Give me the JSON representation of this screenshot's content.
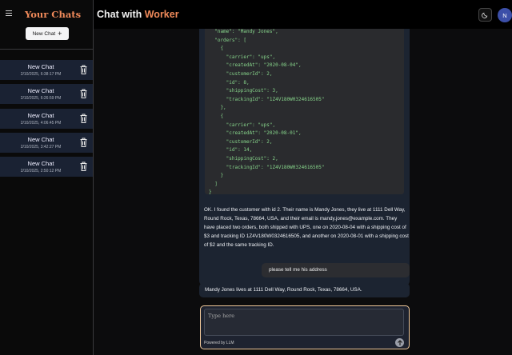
{
  "sidebar": {
    "title": "Your Chats",
    "new_chat_label": "New Chat",
    "chats": [
      {
        "title": "New Chat",
        "date": "2/10/2025, 6:38:17 PM"
      },
      {
        "title": "New Chat",
        "date": "2/10/2025, 6:26:59 PM"
      },
      {
        "title": "New Chat",
        "date": "2/10/2025, 4:06:45 PM"
      },
      {
        "title": "New Chat",
        "date": "2/10/2025, 3:42:27 PM"
      },
      {
        "title": "New Chat",
        "date": "2/10/2025, 2:50:12 PM"
      }
    ]
  },
  "header": {
    "title_prefix": "Chat with",
    "title_accent": "Worker",
    "avatar_initial": "N"
  },
  "messages": {
    "code": "  \"name\": \"Mandy Jones\",\n  \"orders\": [\n    {\n      \"carrier\": \"ups\",\n      \"createdAt\": \"2020-08-04\",\n      \"customerId\": 2,\n      \"id\": 8,\n      \"shippingCost\": 3,\n      \"trackingId\": \"1Z4V180W0324616505\"\n    },\n    {\n      \"carrier\": \"ups\",\n      \"createdAt\": \"2020-08-01\",\n      \"customerId\": 2,\n      \"id\": 14,\n      \"shippingCost\": 2,\n      \"trackingId\": \"1Z4V180W0324616505\"\n    }\n  ]\n}",
    "ai_text": "OK. I found the customer with id 2.  Their name is Mandy Jones, they live at 1111 Dell Way, Round Rock, Texas, 78664, USA, and their email is mandy.jones@example.com. They have placed two orders, both shipped with UPS, one on 2020-08-04 with a shipping cost of $3 and tracking ID 1Z4V180W0324616505, and another on 2020-08-01 with a shipping cost of $2 and the same tracking ID.",
    "user_text": "please tell me his address",
    "ai_reply": "Mandy Jones lives at 1111 Dell Way, Round Rock, Texas, 78664, USA."
  },
  "composer": {
    "placeholder": "Type here",
    "powered_by": "Powered by LLM"
  },
  "icons": {
    "menu": "hamburger-icon",
    "new_chat": "plus-icon",
    "delete": "trash-icon",
    "theme": "moon-icon",
    "send": "arrow-up-icon"
  },
  "colors": {
    "accent": "#f08a5a",
    "chat_item_bg": "#1a2233",
    "ai_bubble": "#1c2431",
    "user_bubble": "#2c2d31",
    "code_text": "#86d38a",
    "composer_border": "#f0c99a"
  }
}
